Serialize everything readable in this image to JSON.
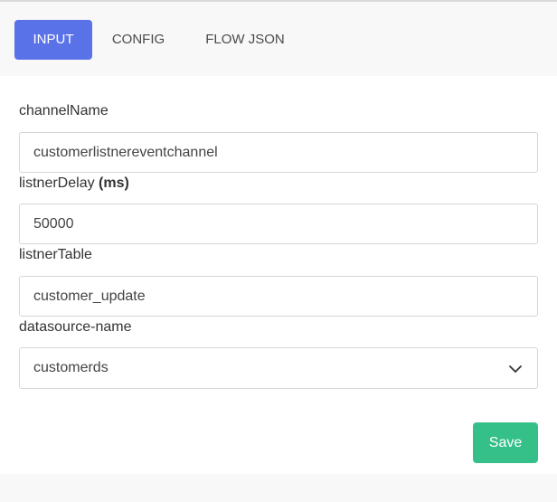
{
  "tabs": [
    {
      "label": "INPUT",
      "active": true
    },
    {
      "label": "CONFIG",
      "active": false
    },
    {
      "label": "FLOW JSON",
      "active": false
    }
  ],
  "form": {
    "channel_name": {
      "label": "channelName",
      "value": "customerlistnereventchannel"
    },
    "listner_delay": {
      "label": "listnerDelay",
      "label_unit": "(ms)",
      "value": "50000"
    },
    "listner_table": {
      "label": "listnerTable",
      "value": "customer_update"
    },
    "datasource_name": {
      "label": "datasource-name",
      "value": "customerds"
    }
  },
  "actions": {
    "save_label": "Save"
  },
  "colors": {
    "accent": "#5a72e8",
    "save": "#35c08a"
  },
  "icons": {
    "select_chevron": "chevron-down-icon"
  }
}
